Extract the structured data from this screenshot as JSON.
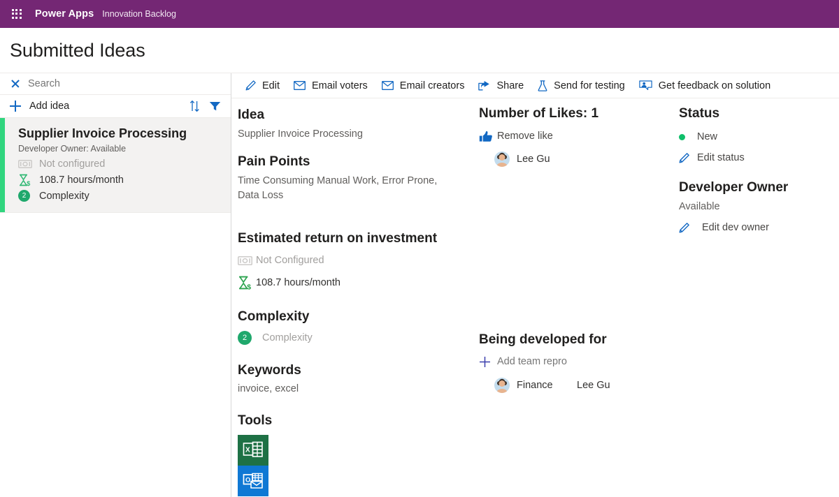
{
  "suite": {
    "waffle_icon": "waffle-grid-icon",
    "brand": "Power Apps",
    "app_name": "Innovation Backlog",
    "bar_color": "#742774"
  },
  "page": {
    "title": "Submitted Ideas"
  },
  "left_panel": {
    "search": {
      "clear_icon": "close-x-icon",
      "placeholder": "Search",
      "value": ""
    },
    "add": {
      "plus_icon": "plus-icon",
      "label": "Add idea",
      "sort_icon": "sort-icon",
      "filter_icon": "filter-icon"
    },
    "items": [
      {
        "accent_color": "#30d57e",
        "title": "Supplier Invoice Processing",
        "subtitle": "Developer Owner: Available",
        "roi_money_icon": "money-icon",
        "roi_money_text": "Not configured",
        "roi_hours_icon": "hourglass-dollar-icon",
        "roi_hours_text": "108.7 hours/month",
        "complexity_badge": "2",
        "complexity_label": "Complexity"
      }
    ]
  },
  "command_bar": {
    "items": [
      {
        "icon": "pencil-icon",
        "label": "Edit"
      },
      {
        "icon": "envelope-icon",
        "label": "Email voters"
      },
      {
        "icon": "envelope-icon",
        "label": "Email creators"
      },
      {
        "icon": "share-icon",
        "label": "Share"
      },
      {
        "icon": "flask-icon",
        "label": "Send for testing"
      },
      {
        "icon": "feedback-person-icon",
        "label": "Get feedback on solution"
      }
    ]
  },
  "detail": {
    "idea": {
      "heading": "Idea",
      "value": "Supplier Invoice Processing"
    },
    "pain_points": {
      "heading": "Pain Points",
      "value": "Time Consuming Manual Work, Error Prone, Data Loss"
    },
    "roi": {
      "heading": "Estimated return on investment",
      "money_icon": "money-icon",
      "money_text": "Not Configured",
      "hours_icon": "hourglass-dollar-icon",
      "hours_text": "108.7 hours/month"
    },
    "complexity": {
      "heading": "Complexity",
      "badge": "2",
      "label": "Complexity"
    },
    "keywords": {
      "heading": "Keywords",
      "value": "invoice, excel"
    },
    "tools": {
      "heading": "Tools",
      "items": [
        {
          "icon": "excel-icon",
          "name": "Excel",
          "color": "#1e7145"
        },
        {
          "icon": "outlook-icon",
          "name": "Outlook",
          "color": "#0f78d4"
        }
      ]
    },
    "likes": {
      "heading": "Number of Likes: 1",
      "count": "1",
      "action_icon": "thumbs-up-icon",
      "action_label": "Remove like",
      "voters": [
        {
          "avatar": "user-avatar",
          "name": "Lee Gu"
        }
      ]
    },
    "developed_for": {
      "heading": "Being developed for",
      "add_icon": "plus-icon",
      "add_label": "Add team repro",
      "rows": [
        {
          "avatar": "user-avatar",
          "team": "Finance",
          "person": "Lee Gu"
        }
      ]
    },
    "status": {
      "heading": "Status",
      "dot_color": "#0fbf6a",
      "value": "New",
      "edit_icon": "pencil-icon",
      "edit_label": "Edit status"
    },
    "dev_owner": {
      "heading": "Developer Owner",
      "value": "Available",
      "edit_icon": "pencil-icon",
      "edit_label": "Edit dev owner"
    }
  }
}
